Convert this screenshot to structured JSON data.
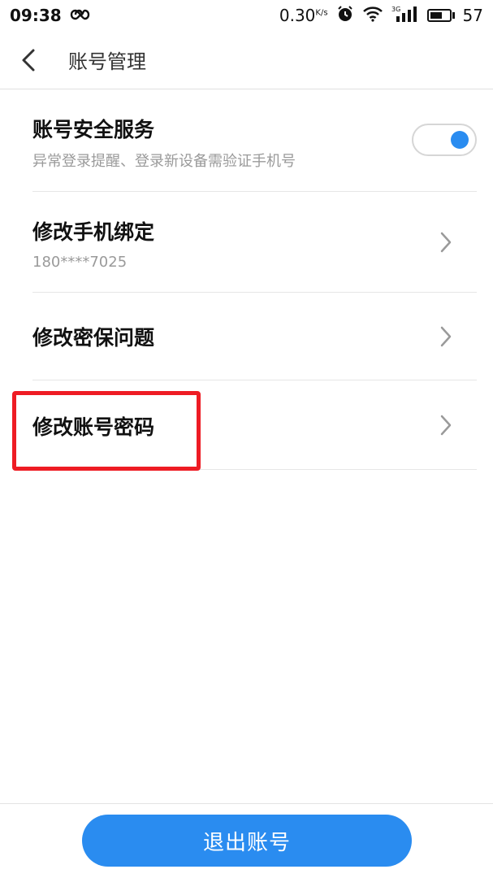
{
  "status_bar": {
    "time": "09:38",
    "net_speed": "0.30",
    "net_speed_unit": "K/s",
    "signal_label": "3G",
    "battery": "57",
    "icons": [
      "infinity-icon",
      "alarm-icon",
      "wifi-icon",
      "signal-icon",
      "battery-icon"
    ]
  },
  "header": {
    "title": "账号管理",
    "back_icon": "back-arrow-icon"
  },
  "settings": {
    "items": [
      {
        "title": "账号安全服务",
        "subtitle": "异常登录提醒、登录新设备需验证手机号",
        "toggle_on": true
      },
      {
        "title": "修改手机绑定",
        "subtitle": "180****7025"
      },
      {
        "title": "修改密保问题"
      },
      {
        "title": "修改账号密码"
      }
    ]
  },
  "logout": {
    "label": "退出账号"
  },
  "colors": {
    "accent": "#2a8cf0",
    "highlight": "#ee1c24"
  }
}
